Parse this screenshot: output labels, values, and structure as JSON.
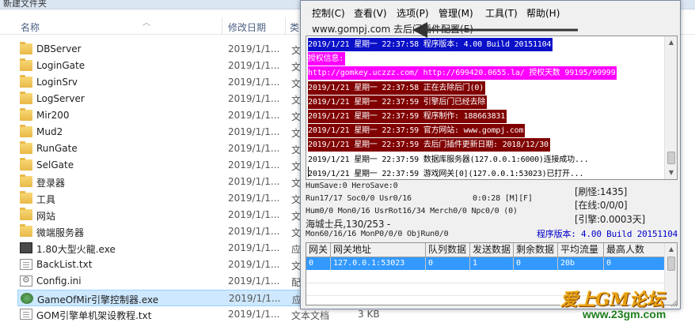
{
  "explorer": {
    "title": "新建文件夹",
    "columns": {
      "name": "名称",
      "date": "修改日期",
      "type": "类"
    },
    "files": [
      {
        "name": "DBServer",
        "date": "2019/1/1...",
        "type": "文",
        "icon": "folder-icon"
      },
      {
        "name": "LoginGate",
        "date": "2019/1/1...",
        "type": "文",
        "icon": "folder-icon"
      },
      {
        "name": "LoginSrv",
        "date": "2019/1/1...",
        "type": "文",
        "icon": "folder-icon"
      },
      {
        "name": "LogServer",
        "date": "2019/1/1...",
        "type": "文",
        "icon": "folder-icon"
      },
      {
        "name": "Mir200",
        "date": "2019/1/1...",
        "type": "文",
        "icon": "folder-icon"
      },
      {
        "name": "Mud2",
        "date": "2019/1/1...",
        "type": "文",
        "icon": "folder-icon"
      },
      {
        "name": "RunGate",
        "date": "2019/1/1...",
        "type": "文",
        "icon": "folder-icon"
      },
      {
        "name": "SelGate",
        "date": "2019/1/1...",
        "type": "文",
        "icon": "folder-icon"
      },
      {
        "name": "登录器",
        "date": "2019/1/1...",
        "type": "文",
        "icon": "folder-icon"
      },
      {
        "name": "工具",
        "date": "2019/1/1...",
        "type": "文",
        "icon": "folder-icon"
      },
      {
        "name": "网站",
        "date": "2019/1/1...",
        "type": "文",
        "icon": "folder-icon"
      },
      {
        "name": "微端服务器",
        "date": "2019/1/1...",
        "type": "文",
        "icon": "folder-icon"
      },
      {
        "name": "1.80大型火龍.exe",
        "date": "2019/1/1...",
        "type": "应",
        "icon": "exe-icon"
      },
      {
        "name": "BackList.txt",
        "date": "2019/1/1...",
        "type": "文",
        "icon": "txt-icon"
      },
      {
        "name": "Config.ini",
        "date": "2019/1/1...",
        "type": "配",
        "icon": "ini-icon"
      },
      {
        "name": "GameOfMir引擎控制器.exe",
        "date": "2019/1/1...",
        "type": "应",
        "icon": "gom-icon",
        "selected": true
      },
      {
        "name": "GOM引擎单机架设教程.txt",
        "date": "2019/1/1...",
        "type": "文本文档",
        "size": "3 KB",
        "icon": "txt-icon"
      }
    ]
  },
  "control": {
    "menu": [
      "控制(C)",
      "查看(V)",
      "选项(P)",
      "管理(M)",
      "工具(T)",
      "帮助(H)"
    ],
    "sub_menu": "www.gompj.com 去后门插件配置(E)",
    "log": [
      {
        "text": "2019/1/21 星期一 22:37:58 程序版本: 4.00 Build 20151104",
        "style": "hl-blue"
      },
      {
        "text": "授权信息:",
        "style": "hl-magenta"
      },
      {
        "text": "http://gomkey.uczzz.com/ http://699420.0655.la/ 授权天数 99195/99999",
        "style": "hl-magenta"
      },
      {
        "text": "2019/1/21 星期一 22:37:58 正在去除后门(0)",
        "style": "hl-darkred"
      },
      {
        "text": "2019/1/21 星期一 22:37:59 引擎后门已经去除",
        "style": "hl-darkred"
      },
      {
        "text": "2019/1/21 星期一 22:37:59 程序制作: 188663831",
        "style": "hl-darkred"
      },
      {
        "text": "2019/1/21 星期一 22:37:59 官方网站: www.gompj.com",
        "style": "hl-darkred"
      },
      {
        "text": "2019/1/21 星期一 22:37:59 去后门插件更新日期: 2018/12/30",
        "style": "hl-darkred"
      },
      {
        "text": "2019/1/21 星期一 22:37:59 数据库服务器(127.0.0.1:6000)连接成功...",
        "style": "plain"
      },
      {
        "text": "2019/1/21 星期一 22:37:59 游戏网关[0](127.0.0.1:53023)已打开...",
        "style": "plain"
      }
    ],
    "status": {
      "hum_save": "HumSave:0 HeroSave:0",
      "run": "Run17/17 Soc0/0 Usr0/16",
      "timer": "0:0:28 [M][F]",
      "refresh": "[刷怪:1435]",
      "hum": "Hum0/0 Mon0/16 UsrRot16/34 Merch0/0 Npc0/0 (0)",
      "online": "[在线:0/0/0]",
      "map": "海城士兵,130/253 -",
      "engine": "[引擎:0.0003天]",
      "mon": "Mon60/16/16 MonP0/0/0 ObjRun0/0",
      "version": "程序版本: 4.00 Build 20151104"
    },
    "grid": {
      "headers": [
        "网关",
        "网关地址",
        "队列数据",
        "发送数据",
        "剩余数据",
        "平均流量",
        "最高人数"
      ],
      "rows": [
        [
          "0",
          "127.0.0.1:53023",
          "0",
          "1",
          "0",
          "20b",
          "0"
        ]
      ]
    }
  },
  "watermark": {
    "title": "爱上GM论坛",
    "url": "www.23gm.com"
  }
}
